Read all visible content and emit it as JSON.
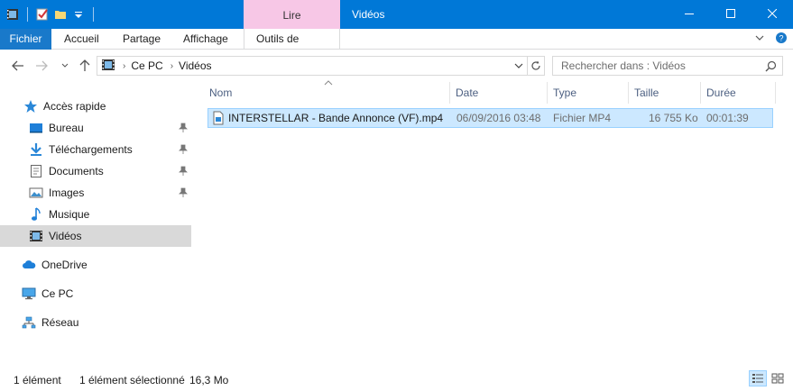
{
  "window": {
    "title": "Vidéos",
    "context_group": "Lire"
  },
  "ribbon": {
    "file": "Fichier",
    "tabs": [
      "Accueil",
      "Partage",
      "Affichage",
      "Outils de vidéo"
    ]
  },
  "address": {
    "crumbs": [
      "Ce PC",
      "Vidéos"
    ],
    "search_placeholder": "Rechercher dans : Vidéos"
  },
  "sidebar": {
    "quick_access": "Accès rapide",
    "items": [
      {
        "label": "Bureau",
        "icon": "desktop-icon",
        "pinned": true
      },
      {
        "label": "Téléchargements",
        "icon": "download-icon",
        "pinned": true
      },
      {
        "label": "Documents",
        "icon": "documents-icon",
        "pinned": true
      },
      {
        "label": "Images",
        "icon": "images-icon",
        "pinned": true
      },
      {
        "label": "Musique",
        "icon": "music-icon",
        "pinned": false
      },
      {
        "label": "Vidéos",
        "icon": "videos-icon",
        "pinned": false,
        "selected": true
      }
    ],
    "onedrive": "OneDrive",
    "this_pc": "Ce PC",
    "network": "Réseau"
  },
  "list": {
    "columns": [
      "Nom",
      "Date",
      "Type",
      "Taille",
      "Durée"
    ],
    "rows": [
      {
        "name": "INTERSTELLAR - Bande Annonce (VF).mp4",
        "date": "06/09/2016 03:48",
        "type": "Fichier MP4",
        "size": "16 755 Ko",
        "duration": "00:01:39"
      }
    ]
  },
  "status": {
    "count": "1 élément",
    "selected": "1 élément sélectionné",
    "size": "16,3 Mo"
  },
  "colors": {
    "titlebar": "#0078d7",
    "context_tab": "#f7c7e6",
    "file_tab": "#1979ca",
    "selection": "#cce8ff"
  }
}
